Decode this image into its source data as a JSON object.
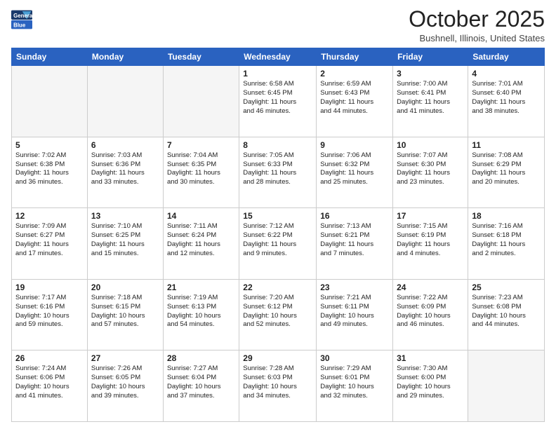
{
  "header": {
    "logo_line1": "General",
    "logo_line2": "Blue",
    "month": "October 2025",
    "location": "Bushnell, Illinois, United States"
  },
  "days_of_week": [
    "Sunday",
    "Monday",
    "Tuesday",
    "Wednesday",
    "Thursday",
    "Friday",
    "Saturday"
  ],
  "weeks": [
    [
      {
        "day": "",
        "text": ""
      },
      {
        "day": "",
        "text": ""
      },
      {
        "day": "",
        "text": ""
      },
      {
        "day": "1",
        "text": "Sunrise: 6:58 AM\nSunset: 6:45 PM\nDaylight: 11 hours\nand 46 minutes."
      },
      {
        "day": "2",
        "text": "Sunrise: 6:59 AM\nSunset: 6:43 PM\nDaylight: 11 hours\nand 44 minutes."
      },
      {
        "day": "3",
        "text": "Sunrise: 7:00 AM\nSunset: 6:41 PM\nDaylight: 11 hours\nand 41 minutes."
      },
      {
        "day": "4",
        "text": "Sunrise: 7:01 AM\nSunset: 6:40 PM\nDaylight: 11 hours\nand 38 minutes."
      }
    ],
    [
      {
        "day": "5",
        "text": "Sunrise: 7:02 AM\nSunset: 6:38 PM\nDaylight: 11 hours\nand 36 minutes."
      },
      {
        "day": "6",
        "text": "Sunrise: 7:03 AM\nSunset: 6:36 PM\nDaylight: 11 hours\nand 33 minutes."
      },
      {
        "day": "7",
        "text": "Sunrise: 7:04 AM\nSunset: 6:35 PM\nDaylight: 11 hours\nand 30 minutes."
      },
      {
        "day": "8",
        "text": "Sunrise: 7:05 AM\nSunset: 6:33 PM\nDaylight: 11 hours\nand 28 minutes."
      },
      {
        "day": "9",
        "text": "Sunrise: 7:06 AM\nSunset: 6:32 PM\nDaylight: 11 hours\nand 25 minutes."
      },
      {
        "day": "10",
        "text": "Sunrise: 7:07 AM\nSunset: 6:30 PM\nDaylight: 11 hours\nand 23 minutes."
      },
      {
        "day": "11",
        "text": "Sunrise: 7:08 AM\nSunset: 6:29 PM\nDaylight: 11 hours\nand 20 minutes."
      }
    ],
    [
      {
        "day": "12",
        "text": "Sunrise: 7:09 AM\nSunset: 6:27 PM\nDaylight: 11 hours\nand 17 minutes."
      },
      {
        "day": "13",
        "text": "Sunrise: 7:10 AM\nSunset: 6:25 PM\nDaylight: 11 hours\nand 15 minutes."
      },
      {
        "day": "14",
        "text": "Sunrise: 7:11 AM\nSunset: 6:24 PM\nDaylight: 11 hours\nand 12 minutes."
      },
      {
        "day": "15",
        "text": "Sunrise: 7:12 AM\nSunset: 6:22 PM\nDaylight: 11 hours\nand 9 minutes."
      },
      {
        "day": "16",
        "text": "Sunrise: 7:13 AM\nSunset: 6:21 PM\nDaylight: 11 hours\nand 7 minutes."
      },
      {
        "day": "17",
        "text": "Sunrise: 7:15 AM\nSunset: 6:19 PM\nDaylight: 11 hours\nand 4 minutes."
      },
      {
        "day": "18",
        "text": "Sunrise: 7:16 AM\nSunset: 6:18 PM\nDaylight: 11 hours\nand 2 minutes."
      }
    ],
    [
      {
        "day": "19",
        "text": "Sunrise: 7:17 AM\nSunset: 6:16 PM\nDaylight: 10 hours\nand 59 minutes."
      },
      {
        "day": "20",
        "text": "Sunrise: 7:18 AM\nSunset: 6:15 PM\nDaylight: 10 hours\nand 57 minutes."
      },
      {
        "day": "21",
        "text": "Sunrise: 7:19 AM\nSunset: 6:13 PM\nDaylight: 10 hours\nand 54 minutes."
      },
      {
        "day": "22",
        "text": "Sunrise: 7:20 AM\nSunset: 6:12 PM\nDaylight: 10 hours\nand 52 minutes."
      },
      {
        "day": "23",
        "text": "Sunrise: 7:21 AM\nSunset: 6:11 PM\nDaylight: 10 hours\nand 49 minutes."
      },
      {
        "day": "24",
        "text": "Sunrise: 7:22 AM\nSunset: 6:09 PM\nDaylight: 10 hours\nand 46 minutes."
      },
      {
        "day": "25",
        "text": "Sunrise: 7:23 AM\nSunset: 6:08 PM\nDaylight: 10 hours\nand 44 minutes."
      }
    ],
    [
      {
        "day": "26",
        "text": "Sunrise: 7:24 AM\nSunset: 6:06 PM\nDaylight: 10 hours\nand 41 minutes."
      },
      {
        "day": "27",
        "text": "Sunrise: 7:26 AM\nSunset: 6:05 PM\nDaylight: 10 hours\nand 39 minutes."
      },
      {
        "day": "28",
        "text": "Sunrise: 7:27 AM\nSunset: 6:04 PM\nDaylight: 10 hours\nand 37 minutes."
      },
      {
        "day": "29",
        "text": "Sunrise: 7:28 AM\nSunset: 6:03 PM\nDaylight: 10 hours\nand 34 minutes."
      },
      {
        "day": "30",
        "text": "Sunrise: 7:29 AM\nSunset: 6:01 PM\nDaylight: 10 hours\nand 32 minutes."
      },
      {
        "day": "31",
        "text": "Sunrise: 7:30 AM\nSunset: 6:00 PM\nDaylight: 10 hours\nand 29 minutes."
      },
      {
        "day": "",
        "text": ""
      }
    ]
  ]
}
